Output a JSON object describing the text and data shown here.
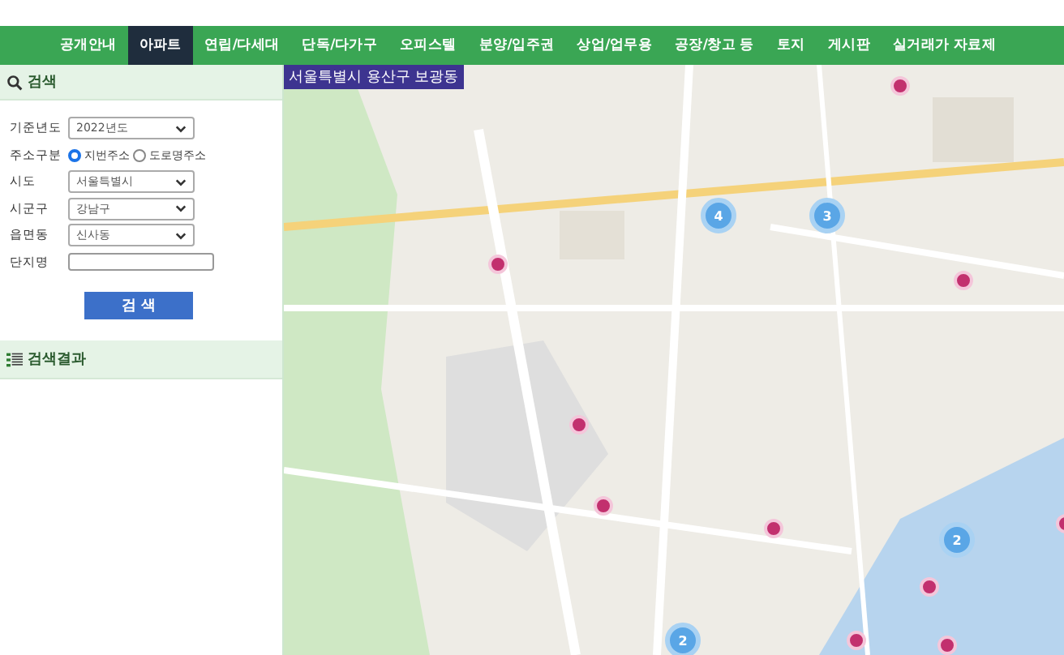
{
  "nav": {
    "items": [
      {
        "label": "공개안내",
        "selected": false
      },
      {
        "label": "아파트",
        "selected": true
      },
      {
        "label": "연립/다세대",
        "selected": false
      },
      {
        "label": "단독/다가구",
        "selected": false
      },
      {
        "label": "오피스텔",
        "selected": false
      },
      {
        "label": "분양/입주권",
        "selected": false
      },
      {
        "label": "상업/업무용",
        "selected": false
      },
      {
        "label": "공장/창고 등",
        "selected": false
      },
      {
        "label": "토지",
        "selected": false
      },
      {
        "label": "게시판",
        "selected": false
      },
      {
        "label": "실거래가 자료제",
        "selected": false
      }
    ]
  },
  "search": {
    "title": "검색",
    "fields": [
      {
        "kind": "select",
        "label": "기준년도",
        "value": "2022년도"
      },
      {
        "kind": "radio",
        "label": "주소구분",
        "options": [
          {
            "label": "지번주소",
            "selected": true
          },
          {
            "label": "도로명주소",
            "selected": false
          }
        ]
      },
      {
        "kind": "select",
        "label": "시도",
        "value": "서울특별시"
      },
      {
        "kind": "select",
        "label": "시군구",
        "value": "강남구"
      },
      {
        "kind": "select",
        "label": "읍면동",
        "value": "신사동"
      },
      {
        "kind": "text",
        "label": "단지명"
      }
    ],
    "button": "검 색"
  },
  "results": {
    "title": "검색결과"
  },
  "map": {
    "location": "서울특별시 용산구 보광동",
    "clusters": [
      {
        "count": "4"
      },
      {
        "count": "3"
      },
      {
        "count": "2"
      },
      {
        "count": "2"
      }
    ]
  }
}
